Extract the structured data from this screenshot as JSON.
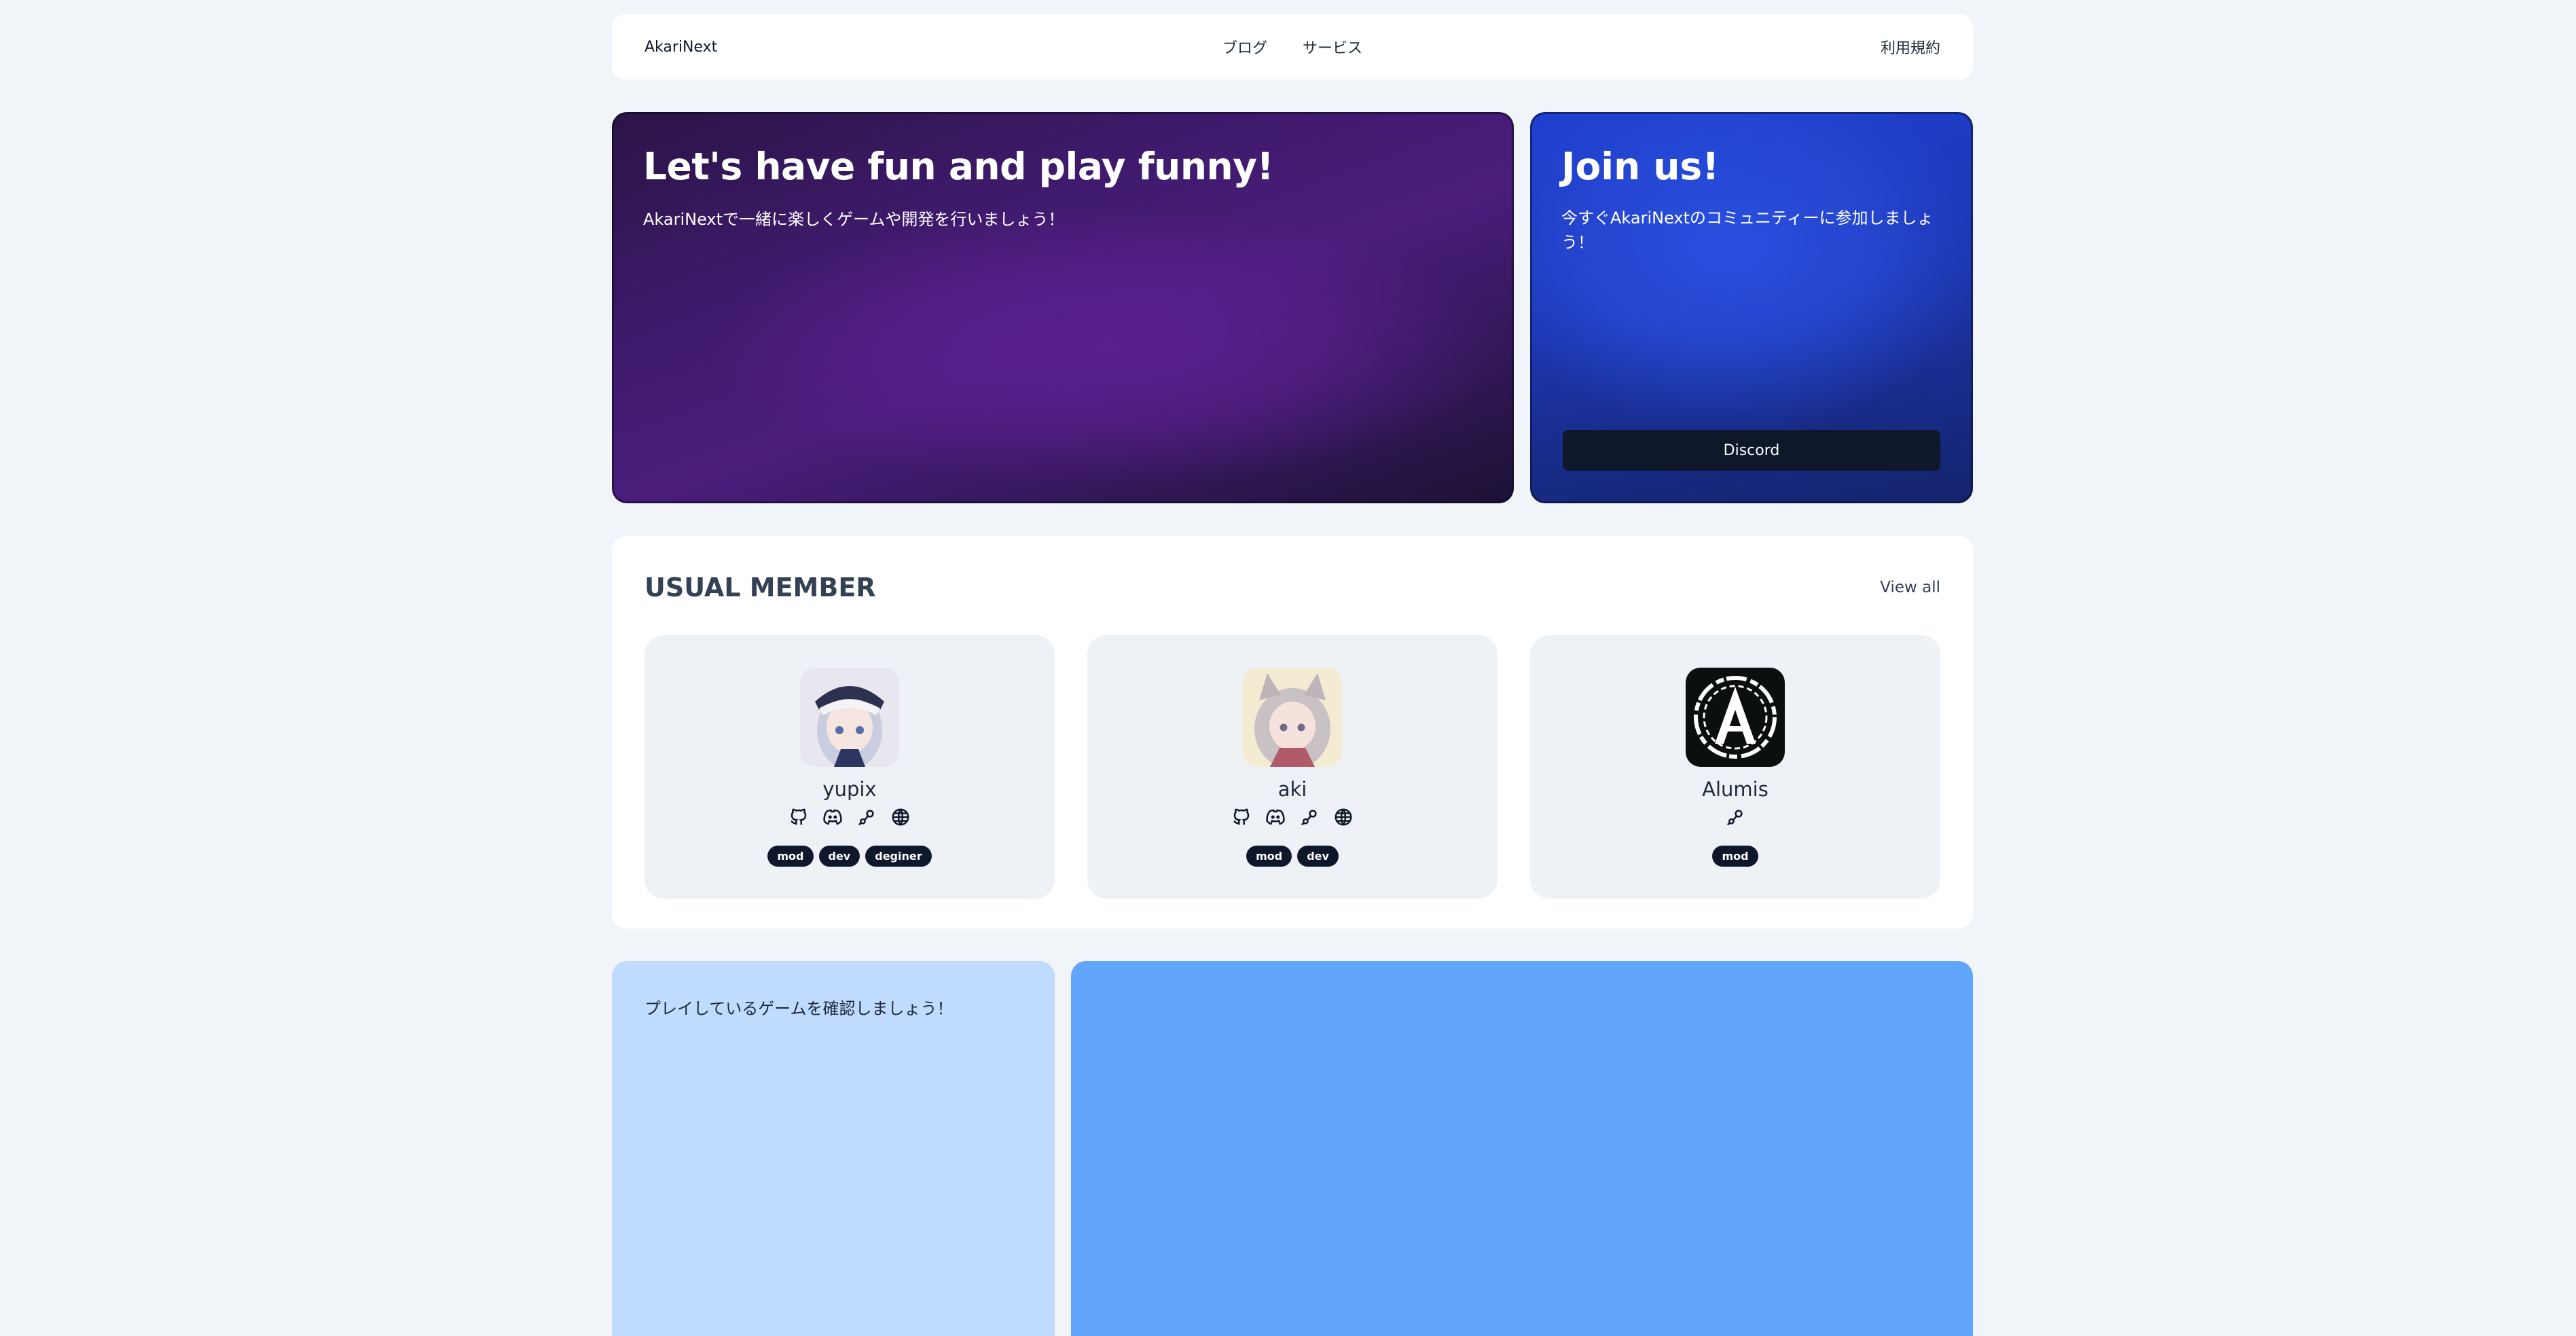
{
  "header": {
    "brand": "AkariNext",
    "nav": [
      "ブログ",
      "サービス"
    ],
    "terms": "利用規約"
  },
  "hero": {
    "title": "Let's have fun and play funny!",
    "subtitle": "AkariNextで一緒に楽しくゲームや開発を行いましょう！"
  },
  "join": {
    "title": "Join us!",
    "text": "今すぐAkariNextのコミュニティーに参加しましょう！",
    "button": "Discord"
  },
  "members": {
    "title": "USUAL MEMBER",
    "view_all": "View all",
    "list": [
      {
        "name": "yupix",
        "icons": [
          "github-icon",
          "discord-icon",
          "steam-icon",
          "globe-icon"
        ],
        "tags": [
          "mod",
          "dev",
          "deginer"
        ]
      },
      {
        "name": "aki",
        "icons": [
          "github-icon",
          "discord-icon",
          "steam-icon",
          "globe-icon"
        ],
        "tags": [
          "mod",
          "dev"
        ]
      },
      {
        "name": "Alumis",
        "icons": [
          "steam-icon"
        ],
        "tags": [
          "mod"
        ]
      }
    ]
  },
  "games": {
    "text": "プレイしているゲームを確認しましょう！"
  },
  "colors": {
    "page_bg": "#f1f5f9",
    "hero_purple": "#5b1f8f",
    "join_blue": "#1f3fd0",
    "dark": "#0f172a",
    "games_light": "#bfdbfe",
    "games_blue": "#60a5fa"
  }
}
